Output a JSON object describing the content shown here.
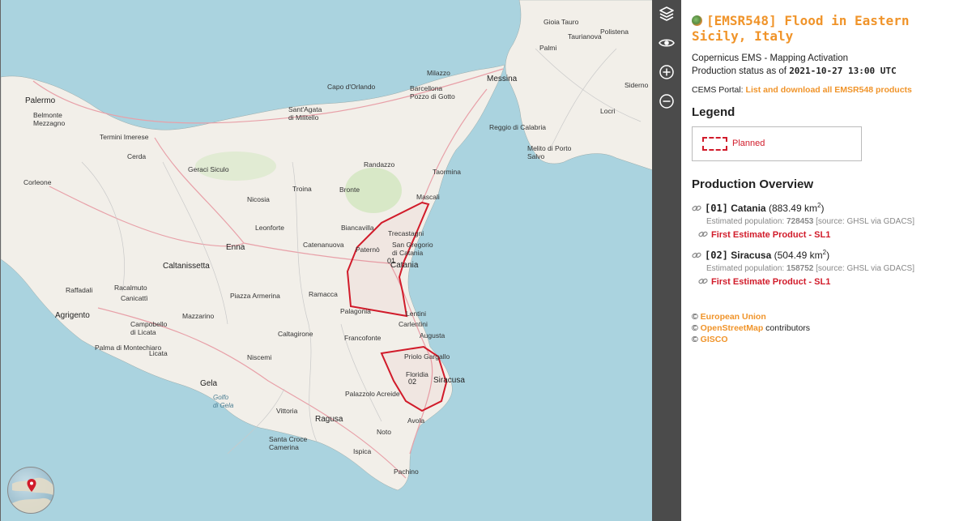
{
  "panel": {
    "title": "[EMSR548] Flood in Eastern Sicily, Italy",
    "subtitle": "Copernicus EMS - Mapping Activation",
    "status_prefix": "Production status as of ",
    "status_date": "2021-10-27 13:00 UTC",
    "portal_prefix": "CEMS Portal: ",
    "portal_link": "List and download all EMSR548 products",
    "legend_heading": "Legend",
    "legend_items": [
      {
        "label": "Planned",
        "color": "#d11b2a"
      }
    ],
    "overview_heading": "Production Overview",
    "aois": [
      {
        "id": "[01]",
        "name": "Catania",
        "area": "(883.49 km",
        "area_sup": "2",
        "area_close": ")",
        "pop_label": "Estimated population: ",
        "pop_value": "728453",
        "pop_source": " [source: GHSL via GDACS]",
        "product": "First Estimate Product - SL1"
      },
      {
        "id": "[02]",
        "name": "Siracusa",
        "area": "(504.49 km",
        "area_sup": "2",
        "area_close": ")",
        "pop_label": "Estimated population: ",
        "pop_value": "158752",
        "pop_source": " [source: GHSL via GDACS]",
        "product": "First Estimate Product - SL1"
      }
    ],
    "credits": [
      {
        "prefix": "© ",
        "link": "European Union",
        "suffix": ""
      },
      {
        "prefix": "© ",
        "link": "OpenStreetMap",
        "suffix": " contributors"
      },
      {
        "prefix": "© ",
        "link": "GISCO",
        "suffix": ""
      }
    ]
  },
  "toolbar": {
    "icons": [
      "layers-icon",
      "eye-icon",
      "zoom-in-icon",
      "zoom-out-icon"
    ]
  },
  "map": {
    "places": {
      "palermo": "Palermo",
      "belmonte": "Belmonte\nMezzagno",
      "corleone": "Corleone",
      "termini": "Termini Imerese",
      "cerda": "Cerda",
      "geraci": "Geraci Siculo",
      "capo": "Capo d'Orlando",
      "santagata": "Sant'Agata\ndi Militello",
      "milazzo": "Milazzo",
      "barcellona": "Barcellona\nPozzo di Gotto",
      "messina": "Messina",
      "reggio": "Reggio di Calabria",
      "polistena": "Polistena",
      "palmi": "Palmi",
      "taurianova": "Taurianova",
      "gioia": "Gioia Tauro",
      "siderno": "Siderno",
      "locri": "Locri",
      "melito": "Melito di Porto\nSalvo",
      "nicosia": "Nicosia",
      "troina": "Troina",
      "randazzo": "Randazzo",
      "bronte": "Bronte",
      "taormina": "Taormina",
      "mascali": "Mascali",
      "enna": "Enna",
      "leonforte": "Leonforte",
      "biancavilla": "Biancavilla",
      "catenanuova": "Catenanuova",
      "trecastagni": "Trecastagni",
      "sangregorio": "San Gregorio\ndi Catania",
      "paterno": "Paternò",
      "catania": "Catania",
      "caltanissetta": "Caltanissetta",
      "raffadali": "Raffadali",
      "racalmuto": "Racalmuto",
      "canicatti": "Canicattì",
      "piazza": "Piazza Armerina",
      "ramacca": "Ramacca",
      "agrigento": "Agrigento",
      "mazzarino": "Mazzarino",
      "palagonia": "Palagonia",
      "lentini": "Lentini",
      "carlentini": "Carlentini",
      "augusta": "Augusta",
      "campobello": "Campobello\ndi Licata",
      "palma": "Palma di Montechiaro",
      "licata": "Licata",
      "caltagirone": "Caltagirone",
      "francofonte": "Francofonte",
      "priolo": "Priolo Gargallo",
      "floridia": "Floridia",
      "siracusa": "Siracusa",
      "niscemi": "Niscemi",
      "palazzolo": "Palazzolo Acreide",
      "gela": "Gela",
      "golfo": "Golfo\ndi Gela",
      "vittoria": "Vittoria",
      "ragusa": "Ragusa",
      "avola": "Avola",
      "noto": "Noto",
      "santacroce": "Santa Croce\nCamerina",
      "ispica": "Ispica",
      "pachino": "Pachino"
    },
    "aoi_labels": {
      "a01": "01",
      "a02": "02"
    },
    "colors": {
      "sea": "#aad3df",
      "land": "#f2efe9",
      "aoi": "#d11b2a",
      "road": "#e8a0a8",
      "border": "#b07fa8"
    }
  }
}
